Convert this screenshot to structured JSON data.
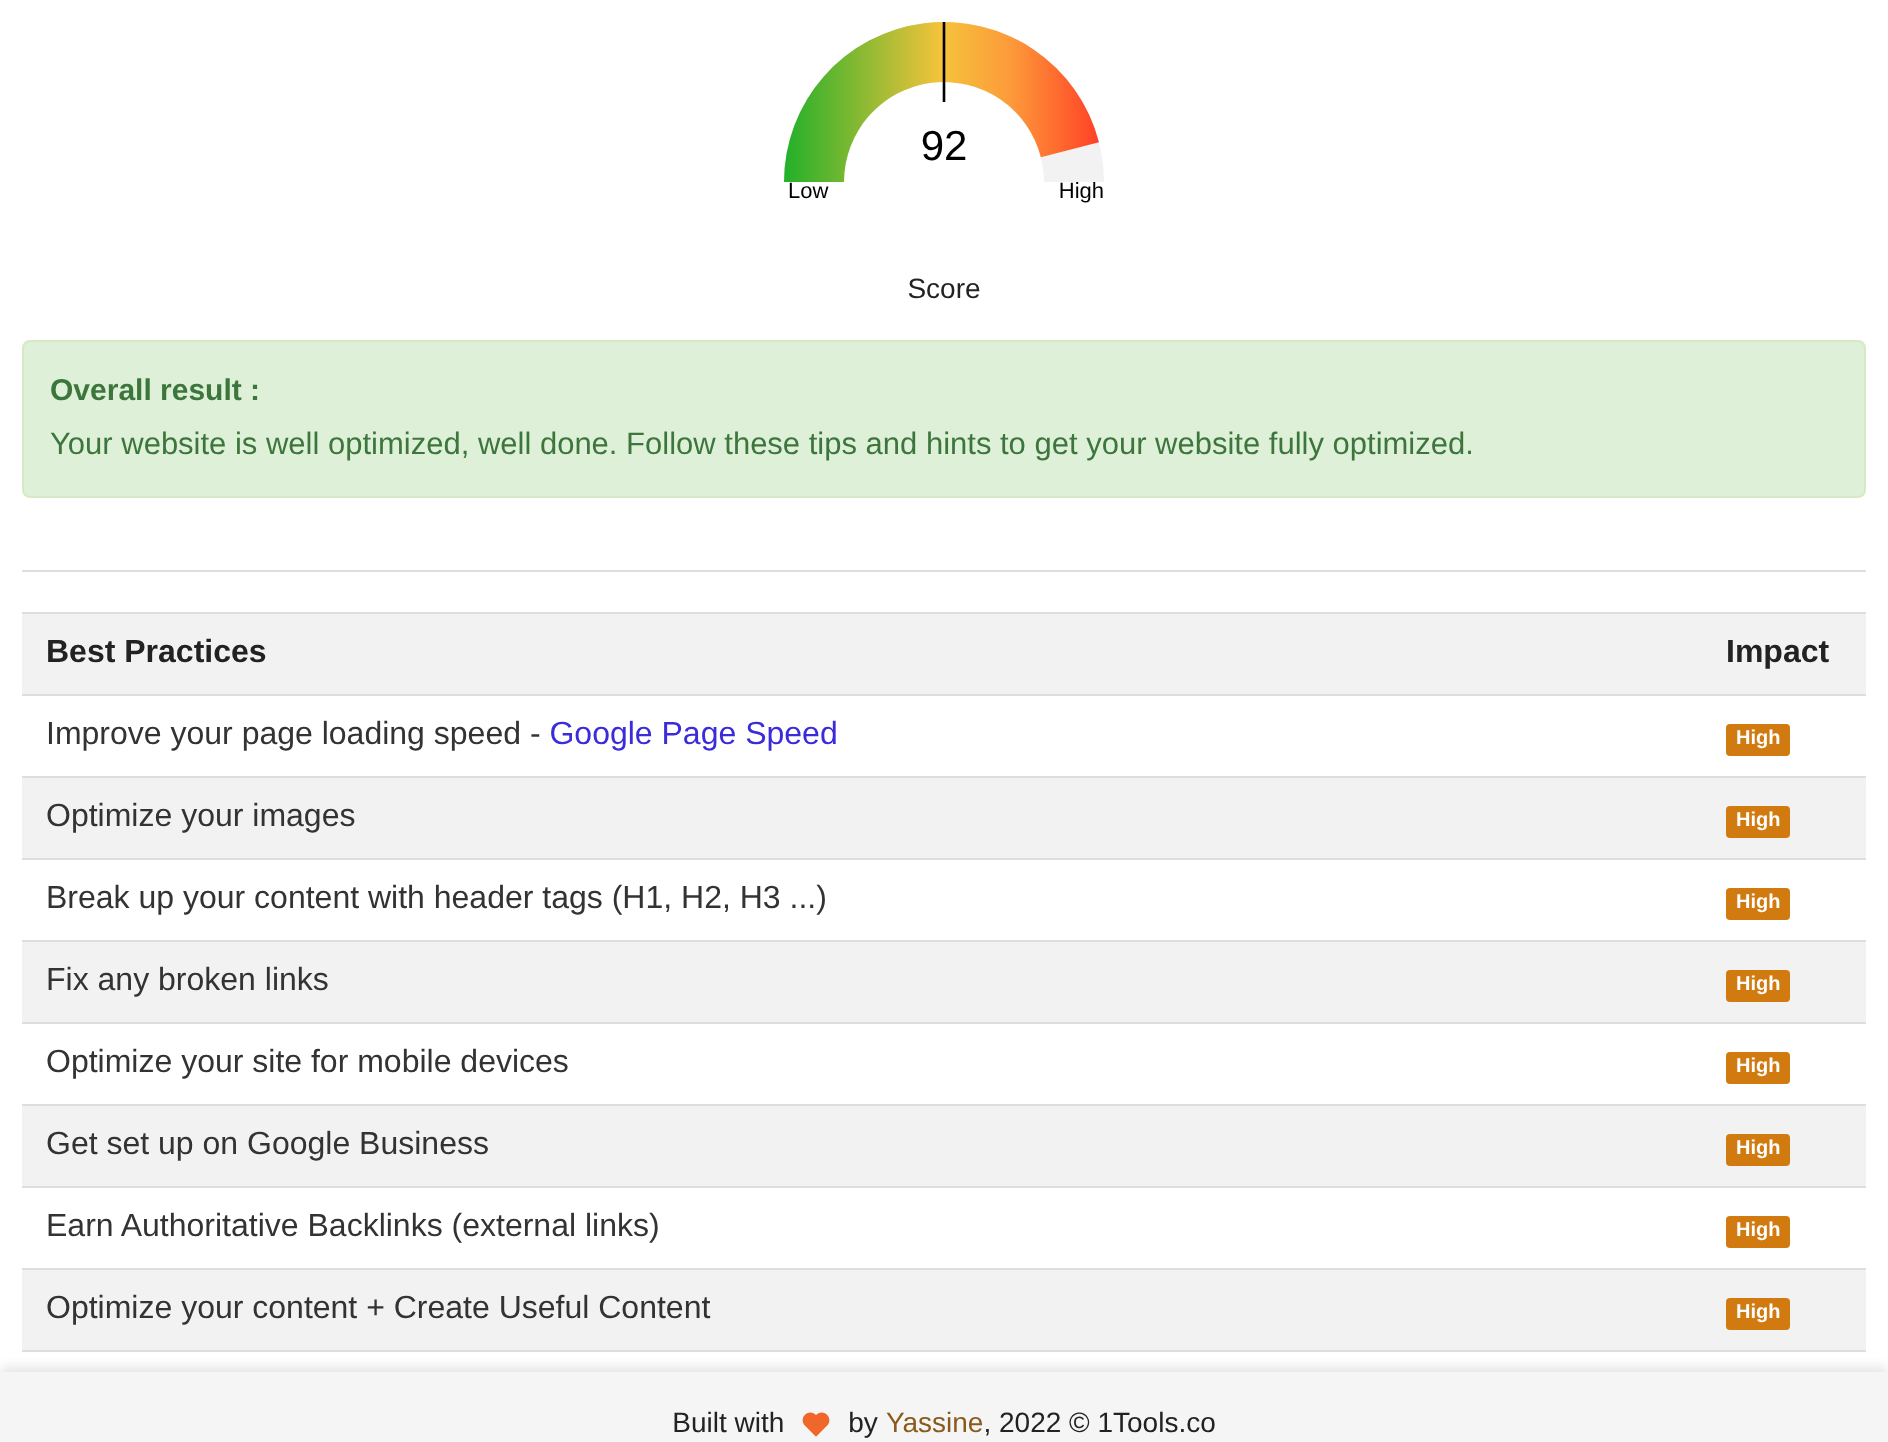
{
  "gauge": {
    "value": "92",
    "min_label": "Low",
    "max_label": "High",
    "caption": "Score"
  },
  "result": {
    "title": "Overall result :",
    "message": "Your website is well optimized, well done. Follow these tips and hints to get your website fully optimized."
  },
  "table": {
    "columns": [
      "Best Practices",
      "Impact"
    ],
    "rows": [
      {
        "text": "Improve your page loading speed - ",
        "link": "Google Page Speed",
        "impact": "High"
      },
      {
        "text": "Optimize your images",
        "impact": "High"
      },
      {
        "text": "Break up your content with header tags (H1, H2, H3 ...)",
        "impact": "High"
      },
      {
        "text": "Fix any broken links",
        "impact": "High"
      },
      {
        "text": "Optimize your site for mobile devices",
        "impact": "High"
      },
      {
        "text": "Get set up on Google Business",
        "impact": "High"
      },
      {
        "text": "Earn Authoritative Backlinks (external links)",
        "impact": "High"
      },
      {
        "text": "Optimize your content + Create Useful Content",
        "impact": "High"
      }
    ]
  },
  "footer": {
    "before": "Built with",
    "by": "by",
    "author": "Yassine",
    "after": ", 2022 © 1Tools.co"
  }
}
